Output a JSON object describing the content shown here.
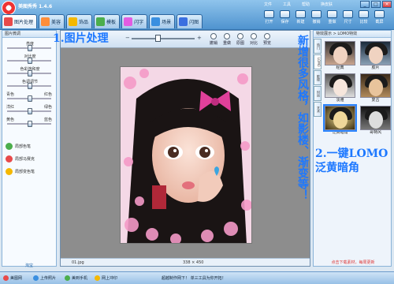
{
  "app": {
    "title": "美图秀秀 1.4.6",
    "menus": [
      "文件",
      "工具",
      "帮助",
      "换皮肤"
    ],
    "window_controls": [
      "_",
      "□",
      "×"
    ]
  },
  "tabs": [
    {
      "label": "图片处理",
      "active": true,
      "color": "#e84a4a"
    },
    {
      "label": "美容",
      "active": false,
      "color": "#ff8e3a"
    },
    {
      "label": "饰品",
      "active": false,
      "color": "#f5b800"
    },
    {
      "label": "模板",
      "active": false,
      "color": "#4cae4c"
    },
    {
      "label": "闪字",
      "active": false,
      "color": "#e25ce2"
    },
    {
      "label": "场景",
      "active": false,
      "color": "#3a8fe0"
    },
    {
      "label": "闪图",
      "active": false,
      "color": "#3a6fe0"
    }
  ],
  "toolbar": [
    "打开",
    "保存",
    "新建",
    "撤销",
    "重做",
    "尺寸",
    "比较",
    "截屏"
  ],
  "annotations": {
    "left": "1.图片处理",
    "right_line1": "2.一键LOMO",
    "right_line2": "泛黄暗角",
    "vertical": "新增很多风格，如影楼、渐变等！"
  },
  "left_panel": {
    "header": "图片微调",
    "sliders": [
      {
        "label": "亮度",
        "value": 0.5
      },
      {
        "label": "对比度",
        "value": 0.5
      },
      {
        "label": "色彩饱和度",
        "value": 0.5
      },
      {
        "label": "色调调节",
        "value": 0.5
      }
    ],
    "color_sliders": [
      {
        "left": "青色",
        "right": "红色",
        "value": 0.5
      },
      {
        "left": "洋红",
        "right": "绿色",
        "value": 0.5
      },
      {
        "left": "黄色",
        "right": "蓝色",
        "value": 0.5
      }
    ],
    "buttons": [
      {
        "label": "局部色笔",
        "color": "#4cae4c"
      },
      {
        "label": "局部马赛克",
        "color": "#e84a4a"
      },
      {
        "label": "局部变色笔",
        "color": "#f5b800"
      }
    ],
    "footer": "淘宝"
  },
  "center": {
    "tools": [
      "撤销",
      "重做",
      "原图",
      "对比",
      "预览"
    ],
    "file_name": "01.jpg",
    "dimensions": "338 × 450"
  },
  "right_panel": {
    "header": "特效展示 > LOMO特效",
    "vtabs": [
      "热门",
      "LOMO",
      "影楼",
      "时尚",
      "艺术"
    ],
    "effects": [
      {
        "label": "经典",
        "selected": false
      },
      {
        "label": "胶片",
        "selected": false
      },
      {
        "label": "淡雅",
        "selected": false
      },
      {
        "label": "复古",
        "selected": false
      },
      {
        "label": "泛黄暗角",
        "selected": true
      },
      {
        "label": "哥特风",
        "selected": false
      }
    ],
    "footer": "点击下载素材，每周更新"
  },
  "bottom_bar": {
    "items": [
      "美图网",
      "上传照片",
      "美到手机",
      "网上冲印"
    ],
    "center_text": "超越制作网下！ 单三工具为你开拓！"
  }
}
